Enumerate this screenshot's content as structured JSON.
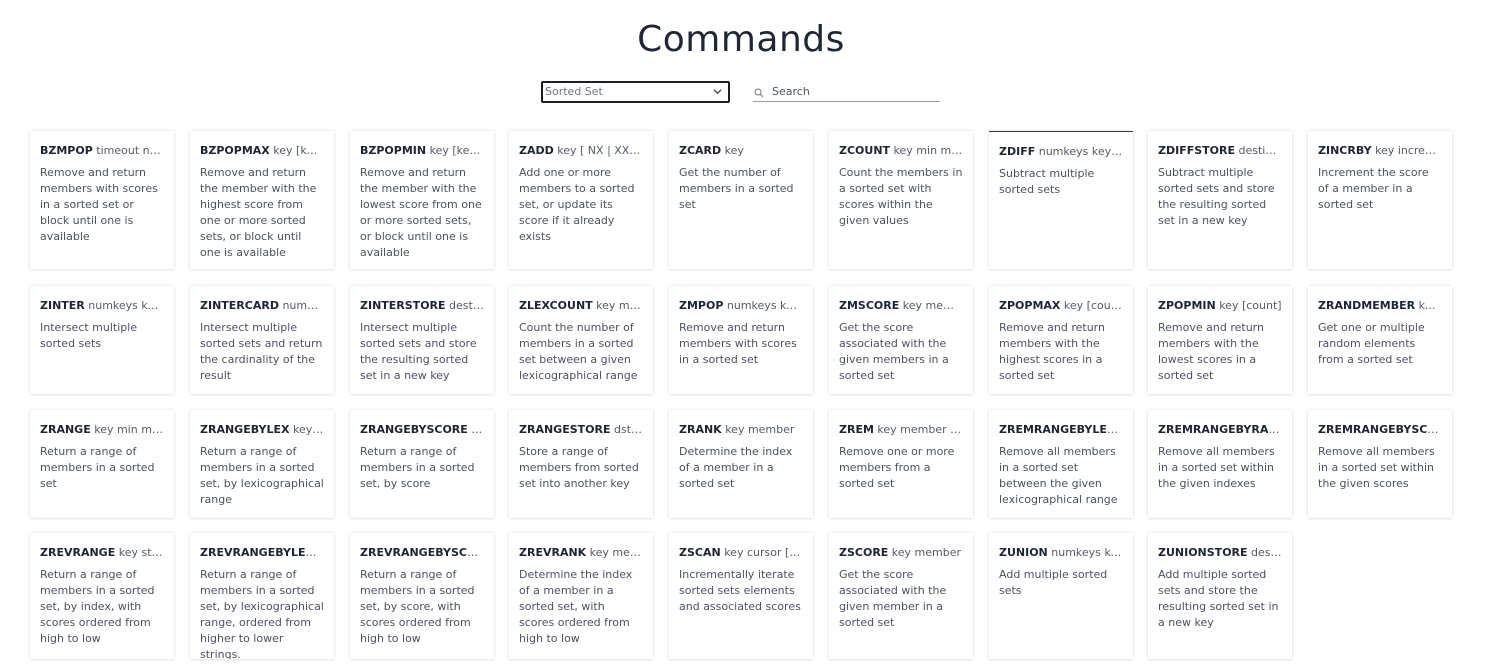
{
  "page": {
    "title": "Commands"
  },
  "filters": {
    "group_selected": "Sorted Set",
    "search_placeholder": "Search"
  },
  "rows": [
    [
      {
        "name": "BZMPOP",
        "args": " timeout numkeys key [key ...] <MIN | MAX> [COUNT count]",
        "summary": "Remove and return members with scores in a sorted set or block until one is available"
      },
      {
        "name": "BZPOPMAX",
        "args": " key [key ...] timeout",
        "summary": "Remove and return the member with the highest score from one or more sorted sets, or block until one is available"
      },
      {
        "name": "BZPOPMIN",
        "args": " key [key ...] timeout",
        "summary": "Remove and return the member with the lowest score from one or more sorted sets, or block until one is available"
      },
      {
        "name": "ZADD",
        "args": " key [ NX | XX] [ GT | LT] [CH] [INCR] score member",
        "summary": "Add one or more members to a sorted set, or update its score if it already exists"
      },
      {
        "name": "ZCARD",
        "args": " key",
        "summary": "Get the number of members in a sorted set"
      },
      {
        "name": "ZCOUNT",
        "args": " key min max",
        "summary": "Count the members in a sorted set with scores within the given values"
      },
      {
        "name": "ZDIFF",
        "args": " numkeys key [key ...] [WITHSCORES]",
        "summary": "Subtract multiple sorted sets"
      },
      {
        "name": "ZDIFFSTORE",
        "args": " destination numkeys key [key ...]",
        "summary": "Subtract multiple sorted sets and store the resulting sorted set in a new key"
      },
      {
        "name": "ZINCRBY",
        "args": " key increment member",
        "summary": "Increment the score of a member in a sorted set"
      }
    ],
    [
      {
        "name": "ZINTER",
        "args": " numkeys key [key ...]",
        "summary": "Intersect multiple sorted sets"
      },
      {
        "name": "ZINTERCARD",
        "args": " numkeys key [key ...]",
        "summary": "Intersect multiple sorted sets and return the cardinality of the result"
      },
      {
        "name": "ZINTERSTORE",
        "args": " destination numkeys key",
        "summary": "Intersect multiple sorted sets and store the resulting sorted set in a new key"
      },
      {
        "name": "ZLEXCOUNT",
        "args": " key min max",
        "summary": "Count the number of members in a sorted set between a given lexicographical range"
      },
      {
        "name": "ZMPOP",
        "args": " numkeys key [key ...]",
        "summary": "Remove and return members with scores in a sorted set"
      },
      {
        "name": "ZMSCORE",
        "args": " key member [member ...]",
        "summary": "Get the score associated with the given members in a sorted set"
      },
      {
        "name": "ZPOPMAX",
        "args": " key [count]",
        "summary": "Remove and return members with the highest scores in a sorted set"
      },
      {
        "name": "ZPOPMIN",
        "args": " key [count]",
        "summary": "Remove and return members with the lowest scores in a sorted set"
      },
      {
        "name": "ZRANDMEMBER",
        "args": " key [count [WITHSCORES]]",
        "summary": "Get one or multiple random elements from a sorted set"
      }
    ],
    [
      {
        "name": "ZRANGE",
        "args": " key min max [BYSCORE | BYLEX]",
        "summary": "Return a range of members in a sorted set"
      },
      {
        "name": "ZRANGEBYLEX",
        "args": " key min max [LIMIT offset count]",
        "summary": "Return a range of members in a sorted set, by lexicographical range"
      },
      {
        "name": "ZRANGEBYSCORE",
        "args": " key min max [WITHSCORES]",
        "summary": "Return a range of members in a sorted set, by score"
      },
      {
        "name": "ZRANGESTORE",
        "args": " dst src min max",
        "summary": "Store a range of members from sorted set into another key"
      },
      {
        "name": "ZRANK",
        "args": " key member",
        "summary": "Determine the index of a member in a sorted set"
      },
      {
        "name": "ZREM",
        "args": " key member [member ...]",
        "summary": "Remove one or more members from a sorted set"
      },
      {
        "name": "ZREMRANGEBYLEX",
        "args": " key min max",
        "summary": "Remove all members in a sorted set between the given lexicographical range"
      },
      {
        "name": "ZREMRANGEBYRANK",
        "args": " key start stop",
        "summary": "Remove all members in a sorted set within the given indexes"
      },
      {
        "name": "ZREMRANGEBYSCORE",
        "args": " key min max",
        "summary": "Remove all members in a sorted set within the given scores"
      }
    ],
    [
      {
        "name": "ZREVRANGE",
        "args": " key start stop [WITHSCORES]",
        "summary": "Return a range of members in a sorted set, by index, with scores ordered from high to low"
      },
      {
        "name": "ZREVRANGEBYLEX",
        "args": " key max min [LIMIT offset count]",
        "summary": "Return a range of members in a sorted set, by lexicographical range, ordered from higher to lower strings."
      },
      {
        "name": "ZREVRANGEBYSCORE",
        "args": " key max min [WITHSCORES]",
        "summary": "Return a range of members in a sorted set, by score, with scores ordered from high to low"
      },
      {
        "name": "ZREVRANK",
        "args": " key member",
        "summary": "Determine the index of a member in a sorted set, with scores ordered from high to low"
      },
      {
        "name": "ZSCAN",
        "args": " key cursor [MATCH pattern] [COUNT count]",
        "summary": "Incrementally iterate sorted sets elements and associated scores"
      },
      {
        "name": "ZSCORE",
        "args": " key member",
        "summary": "Get the score associated with the given member in a sorted set"
      },
      {
        "name": "ZUNION",
        "args": " numkeys key [key ...]",
        "summary": "Add multiple sorted sets"
      },
      {
        "name": "ZUNIONSTORE",
        "args": " destination numkeys key [key ...]",
        "summary": "Add multiple sorted sets and store the resulting sorted set in a new key"
      }
    ]
  ],
  "colors": {
    "active_card_border": "#3a2a6b",
    "text": "#1d2433"
  },
  "icons": {
    "select_chevron": "chevron-down-icon",
    "search": "search-icon"
  }
}
